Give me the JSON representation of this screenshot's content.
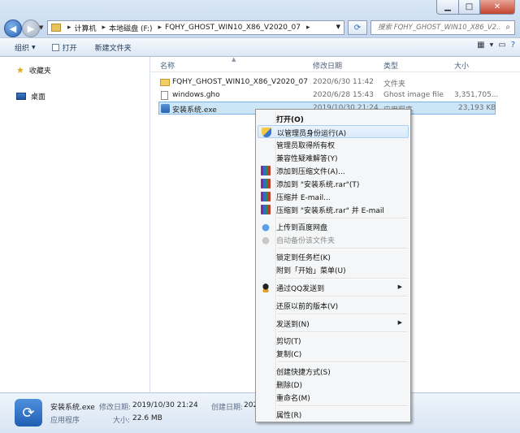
{
  "address": {
    "crumbs": [
      "计算机",
      "本地磁盘 (F:)",
      "FQHY_GHOST_WIN10_X86_V2020_07"
    ],
    "search_placeholder": "搜索 FQHY_GHOST_WIN10_X86_V2..."
  },
  "toolbar": {
    "organize": "组织",
    "open": "打开",
    "new_folder": "新建文件夹"
  },
  "nav": {
    "favorites": "收藏夹",
    "desktop": "桌面"
  },
  "columns": {
    "name": "名称",
    "modified": "修改日期",
    "type": "类型",
    "size": "大小"
  },
  "files": [
    {
      "name": "FQHY_GHOST_WIN10_X86_V2020_07",
      "modified": "2020/6/30 11:42",
      "type": "文件夹",
      "size": "",
      "icon": "folder-icon"
    },
    {
      "name": "windows.gho",
      "modified": "2020/6/28 15:43",
      "type": "Ghost image file",
      "size": "3,351,705...",
      "icon": "file-icon"
    },
    {
      "name": "安装系统.exe",
      "modified": "2019/10/30 21:24",
      "type": "应用程序",
      "size": "23,193 KB",
      "icon": "exe-icon",
      "selected": true
    }
  ],
  "menu": {
    "open": "打开(O)",
    "run_as_admin": "以管理员身份运行(A)",
    "take_ownership": "管理员取得所有权",
    "compat": "兼容性疑难解答(Y)",
    "add_archive": "添加到压缩文件(A)...",
    "add_rar": "添加到 \"安装系统.rar\"(T)",
    "compress_email": "压缩并 E-mail...",
    "compress_rar_email": "压缩到 \"安装系统.rar\" 并 E-mail",
    "upload_baidu": "上传到百度网盘",
    "auto_backup": "自动备份该文件夹",
    "pin_taskbar": "锁定到任务栏(K)",
    "pin_start": "附到「开始」菜单(U)",
    "send_qq": "通过QQ发送到",
    "restore_prev": "还原以前的版本(V)",
    "send_to": "发送到(N)",
    "cut": "剪切(T)",
    "copy": "复制(C)",
    "create_shortcut": "创建快捷方式(S)",
    "delete": "删除(D)",
    "rename": "重命名(M)",
    "properties": "属性(R)"
  },
  "details": {
    "filename": "安装系统.exe",
    "modified_label": "修改日期:",
    "modified": "2019/10/30 21:24",
    "created_label": "创建日期:",
    "created": "202",
    "type": "应用程序",
    "size_label": "大小:",
    "size": "22.6 MB"
  }
}
